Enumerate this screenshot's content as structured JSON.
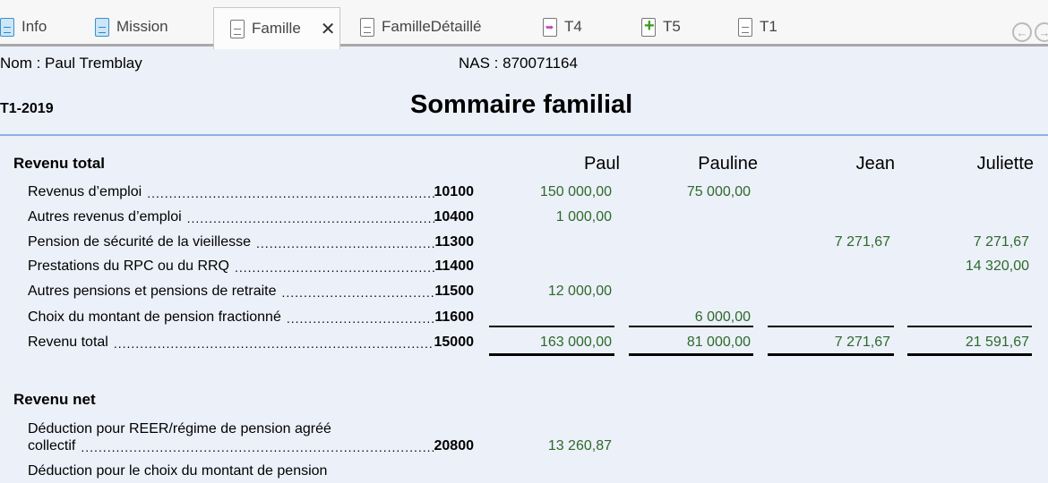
{
  "tabs": [
    {
      "label": "Info",
      "icon": "document-blue-icon"
    },
    {
      "label": "Mission",
      "icon": "document-blue-icon"
    },
    {
      "label": "Famille",
      "icon": "document-icon",
      "active": true
    },
    {
      "label": "FamilleDétaillé",
      "icon": "document-icon"
    },
    {
      "label": "T4",
      "icon": "document-arrow-icon"
    },
    {
      "label": "T5",
      "icon": "document-plus-icon"
    },
    {
      "label": "T1",
      "icon": "document-icon"
    }
  ],
  "close_symbol": "✕",
  "nav": {
    "prev": "←",
    "next": "→"
  },
  "header": {
    "name": "Nom : Paul Tremblay",
    "nas": "NAS : 870071164",
    "form": "T1-2019",
    "title": "Sommaire familial"
  },
  "columns": [
    "Paul",
    "Pauline",
    "Jean",
    "Juliette"
  ],
  "sections": {
    "revenu_total": {
      "title": "Revenu total",
      "rows": [
        {
          "label": "Revenus d’emploi",
          "code": "10100",
          "values": [
            "150 000,00",
            "75 000,00",
            "",
            ""
          ]
        },
        {
          "label": "Autres revenus d’emploi",
          "code": "10400",
          "values": [
            "1 000,00",
            "",
            "",
            ""
          ]
        },
        {
          "label": "Pension de sécurité de la vieillesse",
          "code": "11300",
          "values": [
            "",
            "",
            "7 271,67",
            "7 271,67"
          ]
        },
        {
          "label": "Prestations du RPC ou du RRQ",
          "code": "11400",
          "values": [
            "",
            "",
            "",
            "14 320,00"
          ]
        },
        {
          "label": "Autres pensions et pensions de retraite",
          "code": "11500",
          "values": [
            "12 000,00",
            "",
            "",
            ""
          ]
        },
        {
          "label": "Choix du montant de pension fractionné",
          "code": "11600",
          "values": [
            "",
            "6 000,00",
            "",
            ""
          ]
        },
        {
          "label": "Revenu total",
          "code": "15000",
          "values": [
            "163 000,00",
            "81 000,00",
            "7 271,67",
            "21 591,67"
          ]
        }
      ]
    },
    "revenu_net": {
      "title": "Revenu net",
      "rows": [
        {
          "label_line1": "Déduction pour REER/régime de pension agréé",
          "label": "collectif",
          "code": "20800",
          "values": [
            "13 260,87",
            "",
            "",
            ""
          ]
        },
        {
          "label_line1": "Déduction pour le choix du montant de pension"
        }
      ]
    }
  },
  "colors": {
    "value": "#2d6a2a",
    "accent_line": "#8fb0e0",
    "background": "#ecf0f9"
  }
}
